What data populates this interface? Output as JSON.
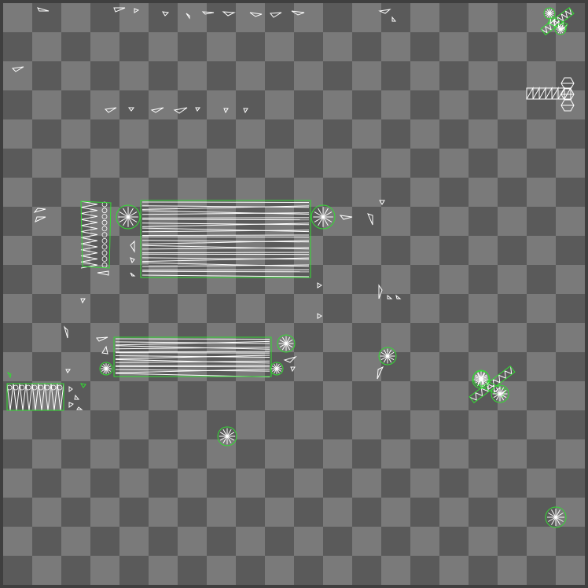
{
  "scene": {
    "background": {
      "frame_color": "#3f3f3f",
      "tile_light": "#7a7a7a",
      "tile_dark": "#5a5a5a"
    },
    "colors": {
      "wire": "#ffffff",
      "bounds": "#33dd33"
    },
    "objects": [
      {
        "name": "mesh-rectangle-large",
        "kind": "hatched-rectangle",
        "outline": true
      },
      {
        "name": "mesh-rectangle-medium",
        "kind": "hatched-rectangle",
        "outline": true
      },
      {
        "name": "mesh-strip-vertical",
        "kind": "zigzag-strip",
        "outline": true
      },
      {
        "name": "mesh-strip-horizontal",
        "kind": "zigzag-strip",
        "outline": true
      },
      {
        "name": "mesh-cross-small",
        "kind": "cross-of-discs",
        "outline": true
      },
      {
        "name": "mesh-cross-large",
        "kind": "cross-of-discs",
        "outline": true
      },
      {
        "name": "mesh-t-shape",
        "kind": "fan-tiles",
        "outline": false
      },
      {
        "name": "wheel-mesh",
        "kind": "radial-disc",
        "outline": true,
        "count": 9
      },
      {
        "name": "triangle-debris",
        "kind": "small-triangles",
        "outline": false,
        "count": 50
      }
    ]
  }
}
